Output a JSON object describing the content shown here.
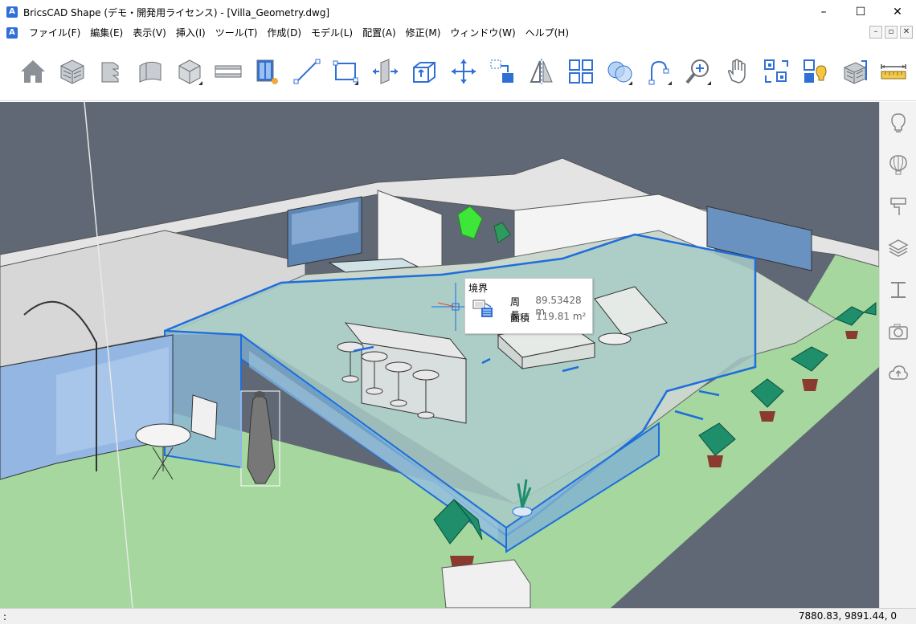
{
  "window": {
    "title": "BricsCAD Shape (デモ・開発用ライセンス) - [Villa_Geometry.dwg]",
    "minimize": "–",
    "maximize": "☐",
    "close": "✕"
  },
  "menu": {
    "items": [
      "ファイル(F)",
      "編集(E)",
      "表示(V)",
      "挿入(I)",
      "ツール(T)",
      "作成(D)",
      "モデル(L)",
      "配置(A)",
      "修正(M)",
      "ウィンドウ(W)",
      "ヘルプ(H)"
    ],
    "mdi_min": "–",
    "mdi_restore": "▫",
    "mdi_close": "✕"
  },
  "toolbar": {
    "tools": [
      "home-icon",
      "brick-wall-icon",
      "stairs-icon",
      "curved-wall-icon",
      "box-solid-icon",
      "beam-icon",
      "window-insert-icon",
      "line-icon",
      "rectangle-icon",
      "push-pull-icon",
      "extrude-box-icon",
      "move-icon",
      "copy-icon",
      "mirror-icon",
      "array-icon",
      "union-icon",
      "arc-icon",
      "zoom-icon",
      "pan-hand-icon",
      "align-icon",
      "light-icon",
      "material-icon",
      "measure-icon"
    ]
  },
  "colors": {
    "viewport_bg": "#5f6874",
    "floor_green": "#a5d79e",
    "selection_blue": "#1e6ddc",
    "accent_blue": "#2f6fd6"
  },
  "tooltip": {
    "title": "境界",
    "perimeter_label": "周長",
    "perimeter_value": "89.53428 m",
    "area_label": "面積",
    "area_value": "119.81 m²"
  },
  "right_panel": {
    "icons": [
      "lightbulb-icon",
      "balloon-icon",
      "paint-roller-icon",
      "layers-icon",
      "column-icon",
      "camera-icon",
      "cloud-upload-icon"
    ]
  },
  "status": {
    "prompt": ":",
    "coordinates": "7880.83, 9891.44, 0"
  }
}
